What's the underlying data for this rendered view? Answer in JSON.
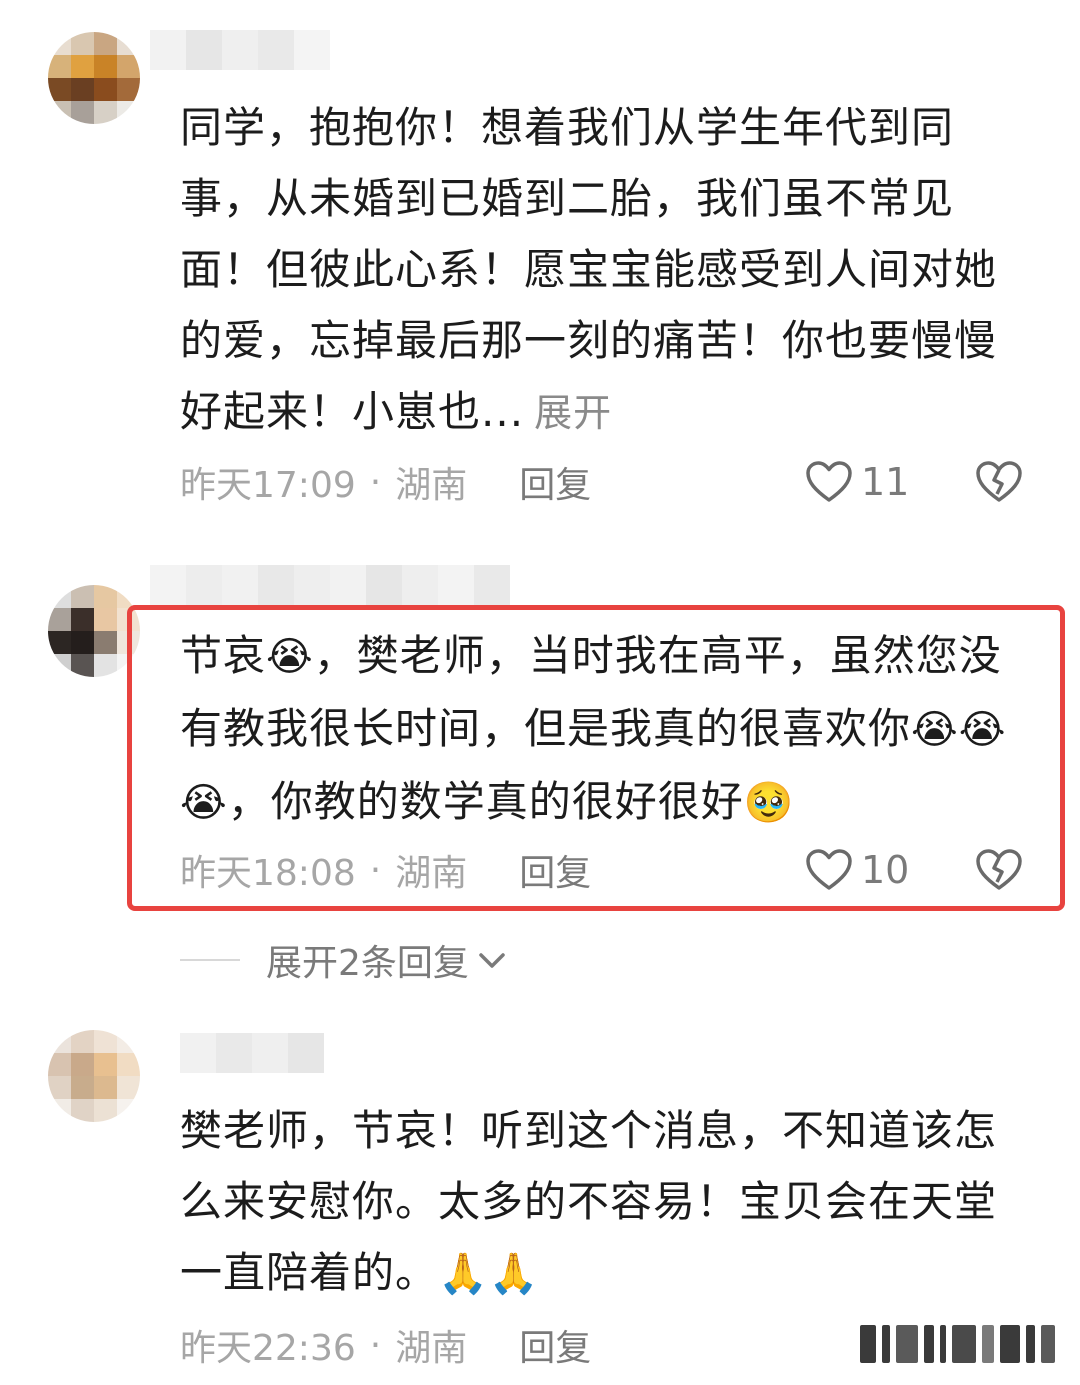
{
  "comments": [
    {
      "text": "同学，抱抱你！想着我们从学生年代到同事，从未婚到已婚到二胎，我们虽不常见面！但彼此心系！愿宝宝能感受到人间对她的爱，忘掉最后那一刻的痛苦！你也要慢慢好起来！小崽也...",
      "expand": "展开",
      "time": "昨天17:09",
      "dot": "·",
      "location": "湖南",
      "reply": "回复",
      "likes": "11",
      "like_icon": "heart-outline-icon",
      "dislike_icon": "broken-heart-icon"
    },
    {
      "text_a": "节哀",
      "emoji_a": "😭",
      "text_b": "，樊老师，当时我在高平，虽然您没有教我很长时间，但是我真的很喜欢你",
      "emoji_b": "😭😭😭",
      "text_c": "，你教的数学真的很好很好",
      "emoji_c": "🥹",
      "time": "昨天18:08",
      "dot": "·",
      "location": "湖南",
      "reply": "回复",
      "likes": "10",
      "replies_expand": "展开2条回复"
    },
    {
      "text": "樊老师，节哀！听到这个消息，不知道该怎么来安慰你。太多的不容易！宝贝会在天堂一直陪着的。",
      "emoji": "🙏🙏",
      "time": "昨天22:36",
      "dot": "·",
      "location": "湖南",
      "reply": "回复"
    }
  ],
  "colors": {
    "highlight": "#e8433f",
    "meta_text": "#a6a6a6"
  }
}
